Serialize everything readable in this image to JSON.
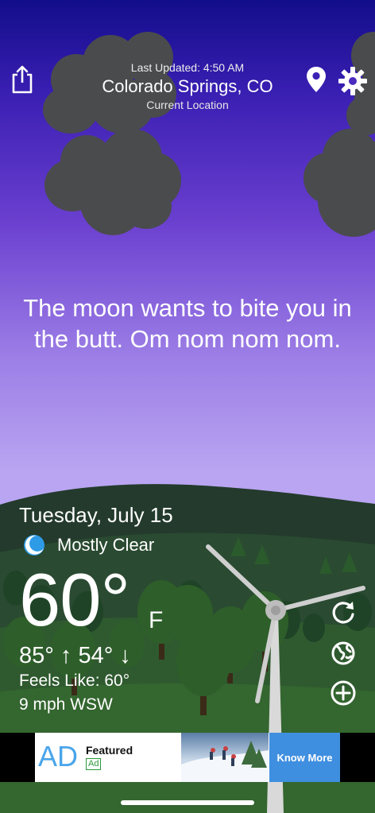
{
  "header": {
    "last_updated": "Last Updated: 4:50 AM",
    "location": "Colorado Springs, CO",
    "location_sub": "Current Location"
  },
  "message": "The moon wants to bite you in the butt. Om nom nom nom.",
  "weather": {
    "date": "Tuesday, July 15",
    "condition": "Mostly Clear",
    "temperature": "60°",
    "unit": "F",
    "high_low": "85° ↑ 54° ↓",
    "feels_like": "Feels Like: 60°",
    "wind": "9 mph WSW"
  },
  "icons": {
    "share": "share-icon",
    "location_pin": "location-pin-icon",
    "settings": "gear-icon",
    "condition": "moon-icon",
    "refresh": "refresh-icon",
    "globe": "globe-icon",
    "add": "plus-circle-icon"
  },
  "ad": {
    "label": "AD",
    "title": "Featured",
    "badge": "Ad",
    "cta": "Know More"
  },
  "colors": {
    "sky_top": "#120d8a",
    "sky_bottom": "#b9a5f1",
    "ad_accent": "#3f8fe0"
  }
}
